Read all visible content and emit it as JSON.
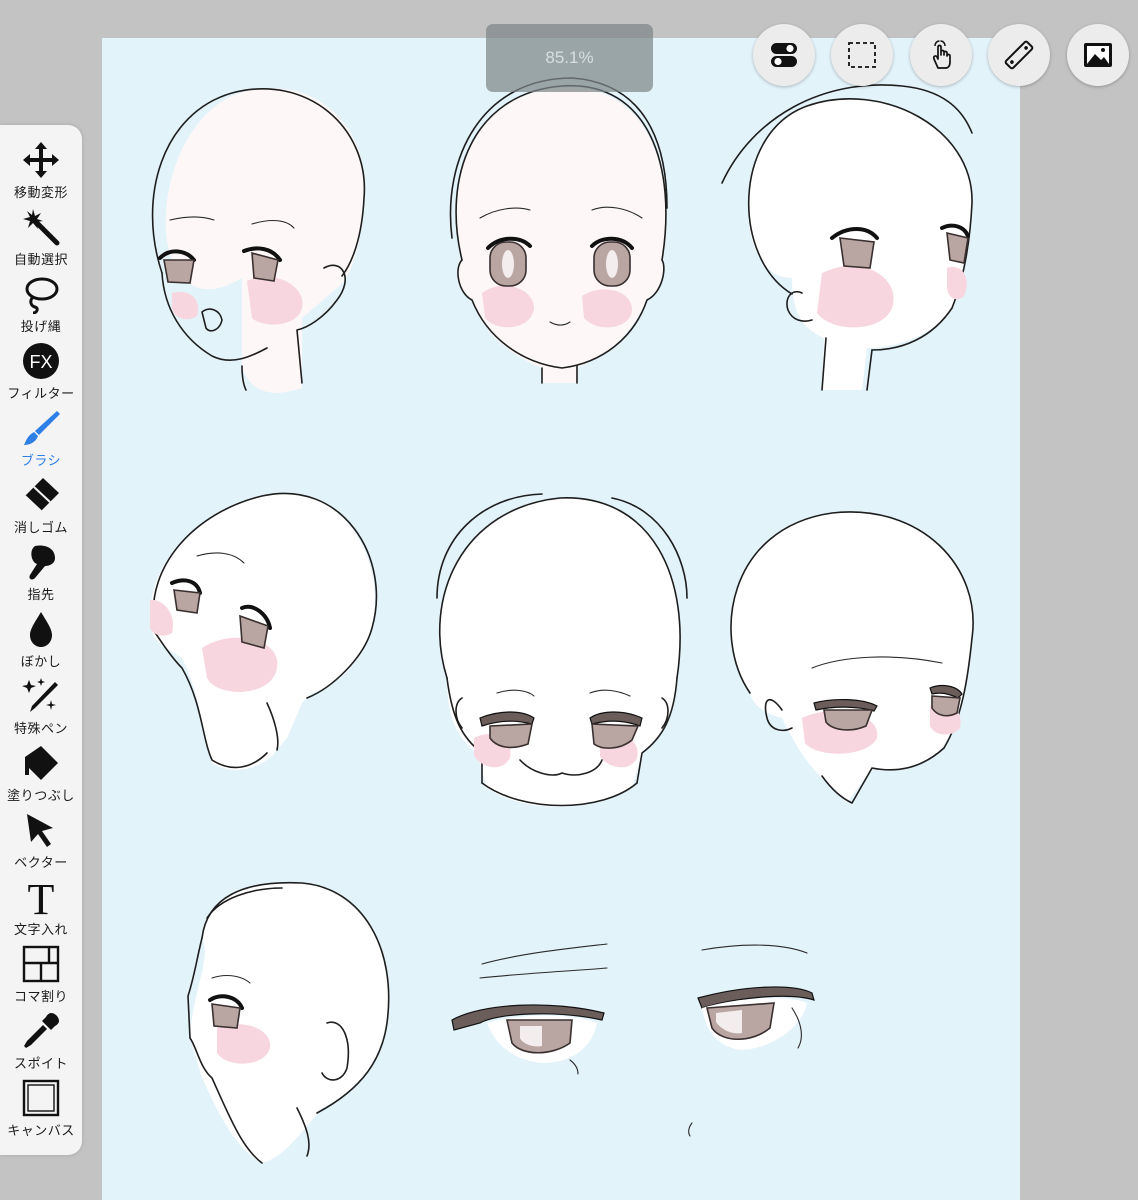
{
  "zoom_label": "85.1%",
  "accent_color": "#2e7fe6",
  "canvas_color": "#e3f3fa",
  "tools": [
    {
      "id": "move",
      "label": "移動変形",
      "icon": "move-arrows-icon"
    },
    {
      "id": "magic",
      "label": "自動選択",
      "icon": "magic-wand-icon"
    },
    {
      "id": "lasso",
      "label": "投げ縄",
      "icon": "lasso-icon"
    },
    {
      "id": "filter",
      "label": "フィルター",
      "icon": "fx-icon"
    },
    {
      "id": "brush",
      "label": "ブラシ",
      "icon": "brush-icon",
      "active": true
    },
    {
      "id": "eraser",
      "label": "消しゴム",
      "icon": "eraser-icon"
    },
    {
      "id": "finger",
      "label": "指先",
      "icon": "finger-smudge-icon"
    },
    {
      "id": "blur",
      "label": "ぼかし",
      "icon": "drop-icon"
    },
    {
      "id": "special",
      "label": "特殊ペン",
      "icon": "special-pen-icon"
    },
    {
      "id": "fill",
      "label": "塗りつぶし",
      "icon": "bucket-icon"
    },
    {
      "id": "vector",
      "label": "ベクター",
      "icon": "cursor-arrow-icon"
    },
    {
      "id": "text",
      "label": "文字入れ",
      "icon": "text-t-icon"
    },
    {
      "id": "frame",
      "label": "コマ割り",
      "icon": "panel-frame-icon"
    },
    {
      "id": "dropper",
      "label": "スポイト",
      "icon": "eyedropper-icon"
    },
    {
      "id": "canvas",
      "label": "キャンバス",
      "icon": "canvas-icon"
    }
  ],
  "top_buttons": [
    "toggle-icon",
    "selection-icon",
    "touch-gesture-icon",
    "ruler-icon",
    "image-icon"
  ]
}
